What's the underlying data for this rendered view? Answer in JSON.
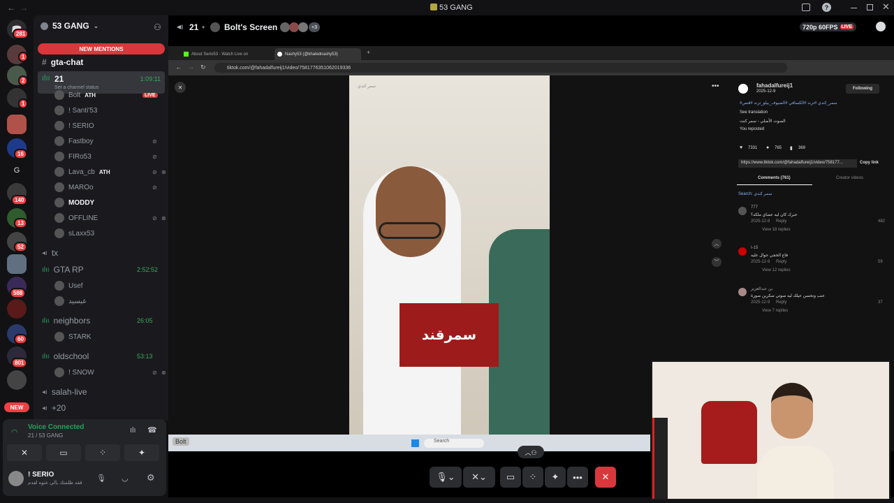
{
  "titlebar": {
    "title": "53 GANG",
    "back": "←",
    "fwd": "→"
  },
  "servers": {
    "badges": [
      "281",
      "1",
      "2",
      "1",
      "16",
      "140",
      "13",
      "52",
      "588",
      "60",
      "801"
    ],
    "letter": "G",
    "new_label": "NEW"
  },
  "server_header": {
    "name": "53 GANG",
    "new_mentions": "NEW MENTIONS"
  },
  "text_channel": "gta-chat",
  "voice": {
    "channel_21": {
      "name": "21",
      "timer": "1:09:11",
      "status": "Set a channel status"
    },
    "members_21": [
      {
        "name": "Bolt",
        "tag": "ATH",
        "live": "LIVE"
      },
      {
        "name": "! Santi'53"
      },
      {
        "name": "! SERIO"
      },
      {
        "name": "Fastboy"
      },
      {
        "name": "FIRo53"
      },
      {
        "name": "Lava_cb",
        "tag": "ATH"
      },
      {
        "name": "MAROo"
      },
      {
        "name": "MODDY"
      },
      {
        "name": "OFFLINE"
      },
      {
        "name": "sLaxx53"
      }
    ],
    "tx": "tx",
    "gtarp": {
      "name": "GTA RP",
      "timer": "2:52:52",
      "members": [
        "Usef",
        "عبسيد"
      ]
    },
    "neighbors": {
      "name": "neighbors",
      "timer": "26:05",
      "members": [
        "STARK"
      ]
    },
    "oldschool": {
      "name": "oldschool",
      "timer": "53:13",
      "members": [
        "! SNOW"
      ]
    },
    "salah": "salah-live",
    "more": "+20"
  },
  "user_panel": {
    "connected": "Voice Connected",
    "server": "21 / 53 GANG",
    "username": "! SERIO",
    "status": "فقد ظلمتك يالي عتوه لقدم"
  },
  "stream_header": {
    "channel": "21",
    "screen": "Bolt's Screen",
    "extra": "+3",
    "quality": "720p 60FPS",
    "live": "LIVE"
  },
  "browser": {
    "tabs": [
      "About Serio53 - Watch Live on",
      "Nashy53 (@khalednashy53)"
    ],
    "url": "tiktok.com/@fahadalfureij1/video/7581776351062019336",
    "author": "fahadalfureij1",
    "follow": "Following",
    "date": "2025-12-9",
    "caption": "#سمر_كندي #ترند #الكسافي #الضيوف_بيلو_ترند #قنص",
    "see_translation": "See translation",
    "sound": "الصوت الأصلي - سمر كنت",
    "reposted": "You reposted",
    "likes": "7331",
    "comments_count": "765",
    "saves": "369",
    "link": "https://www.tiktok.com/@fahadalfureij1/video/758177...",
    "copy_link": "Copy link",
    "tab_comments": "Comments (761)",
    "tab_creator": "Creator videos",
    "search": "Search: سمر كندي",
    "comments": [
      {
        "name": "777",
        "text": "حبرك كان ليه عضاي ملكه؟",
        "date": "2025-12-9",
        "reply": "Reply",
        "likes": "482",
        "view": "View 18 replies"
      },
      {
        "name": "I-15",
        "text": "فاع الخجي جوال عليه",
        "date": "2025-12-9",
        "reply": "Reply",
        "likes": "59",
        "view": "View 12 replies"
      },
      {
        "name": "بن عبدالعزيز",
        "text": "عنب وتحسن عيلك ليه صوتي سكرين صورة",
        "date": "2025-12-9",
        "reply": "Reply",
        "likes": "37",
        "view": "View 7 replies"
      }
    ],
    "video_search": "سمر كندي",
    "logo_text": "سمرقند"
  },
  "taskbar": {
    "search": "Search",
    "bolt": "Bolt"
  },
  "colors": {
    "accent": "#5865f2",
    "red": "#da373c",
    "green": "#23a55a"
  }
}
